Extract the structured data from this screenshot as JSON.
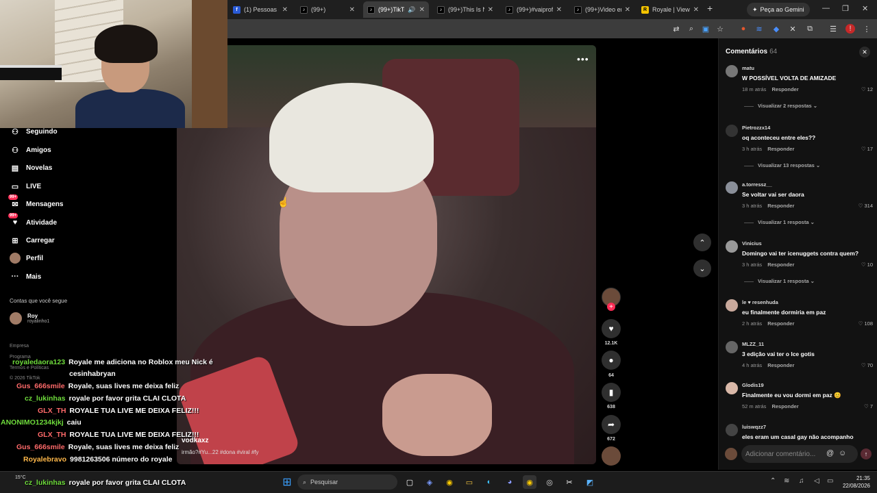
{
  "browser": {
    "tabs": [
      {
        "title": "(1) Pessoas - R",
        "icon": "facebook",
        "active": false
      },
      {
        "title": "(99+)",
        "icon": "tiktok",
        "active": false
      },
      {
        "title": "(99+)TikTo",
        "icon": "tiktok",
        "active": true
      },
      {
        "title": "(99+)This Is N",
        "icon": "tiktok",
        "active": false
      },
      {
        "title": "(99+)#vaiprofy",
        "icon": "tiktok",
        "active": false
      },
      {
        "title": "(99+)Video em",
        "icon": "tiktok",
        "active": false
      },
      {
        "title": "Royale | Viewx",
        "icon": "royale",
        "active": false
      }
    ],
    "gemini_label": "Peça ao Gemini"
  },
  "nav": {
    "items": [
      {
        "label": "Seguindo",
        "icon": "following-icon"
      },
      {
        "label": "Amigos",
        "icon": "friends-icon"
      },
      {
        "label": "Novelas",
        "icon": "novelas-icon"
      },
      {
        "label": "LIVE",
        "icon": "live-icon"
      },
      {
        "label": "Mensagens",
        "icon": "messages-icon",
        "badge": "99+"
      },
      {
        "label": "Atividade",
        "icon": "activity-icon",
        "badge": "99+"
      },
      {
        "label": "Carregar",
        "icon": "upload-icon"
      },
      {
        "label": "Perfil",
        "icon": "profile-icon"
      },
      {
        "label": "Mais",
        "icon": "more-icon"
      }
    ],
    "following_title": "Contas que você segue",
    "account": {
      "name": "Roy",
      "handle": "royalinho1"
    },
    "footer": {
      "empresa": "Empresa",
      "programa": "Programa",
      "termos": "Termos e Políticas",
      "copyright": "© 2026 TikTok"
    }
  },
  "video": {
    "author": "vodkaxz",
    "caption": "irmão?#Yu...22 #dona #viral #fy",
    "likes": "12.1K",
    "comments": "64",
    "saves": "638",
    "shares": "672"
  },
  "comments": {
    "title": "Comentários",
    "count": "64",
    "input_placeholder": "Adicionar comentário...",
    "items": [
      {
        "user": "matu",
        "text": "W POSSÍVEL VOLTA DE AMIZADE",
        "time": "18 m atrás",
        "reply": "Responder",
        "likes": "12",
        "replies": "Visualizar 2 respostas"
      },
      {
        "user": "Pietrozzx14",
        "text": "oq aconteceu entre eles??",
        "time": "3 h atrás",
        "reply": "Responder",
        "likes": "17",
        "replies": "Visualizar 13 respostas"
      },
      {
        "user": "a.torressz__",
        "text": "Se voltar vai ser daora",
        "time": "3 h atrás",
        "reply": "Responder",
        "likes": "314",
        "replies": "Visualizar 1 resposta"
      },
      {
        "user": "Vinicius",
        "text": "Domingo vai ter icenuggets contra quem?",
        "time": "3 h atrás",
        "reply": "Responder",
        "likes": "10",
        "replies": "Visualizar 1 resposta"
      },
      {
        "user": "le ♥ resenhuda",
        "text": "eu finalmente dormiria em paz",
        "time": "2 h atrás",
        "reply": "Responder",
        "likes": "108",
        "replies": ""
      },
      {
        "user": "MLZZ_11",
        "text": "3 edição vai ter o Ice gotis",
        "time": "4 h atrás",
        "reply": "Responder",
        "likes": "70",
        "replies": ""
      },
      {
        "user": "Glodis19",
        "text": "Finalmente eu vou dormi em paz 😊",
        "time": "52 m atrás",
        "reply": "Responder",
        "likes": "7",
        "replies": ""
      },
      {
        "user": "luiswqzz7",
        "text": "eles eram um casal gay não acompanho",
        "time": "",
        "reply": "",
        "likes": "",
        "replies": ""
      }
    ]
  },
  "stream_chat": [
    {
      "user": "royaledaora123",
      "color": "#6fdc3c",
      "msg": "Royale me adiciona no Roblox meu Nick é"
    },
    {
      "user": "",
      "color": "#ffffff",
      "msg": "cesinhabryan"
    },
    {
      "user": "Gus_666smile",
      "color": "#ff6a6a",
      "msg": "Royale, suas lives me deixa feliz"
    },
    {
      "user": "cz_lukinhas",
      "color": "#6fdc3c",
      "msg": "royale por favor grita CLAI CLOTA"
    },
    {
      "user": "GLX_TH",
      "color": "#ff6a6a",
      "msg": "ROYALE TUA LIVE ME DEIXA FELIZ!!!"
    },
    {
      "user": "ANONIMO1234kjkj",
      "color": "#6fdc3c",
      "msg": "caiu"
    },
    {
      "user": "GLX_TH",
      "color": "#ff6a6a",
      "msg": "ROYALE TUA LIVE ME DEIXA FELIZ!!!"
    },
    {
      "user": "Gus_666smile",
      "color": "#ff6a6a",
      "msg": "Royale, suas lives me deixa feliz"
    },
    {
      "user": "Royalebravo",
      "color": "#ffb84a",
      "msg": "9981263506 número do royale"
    },
    {
      "user": "cz_lukinhas",
      "color": "#6fdc3c",
      "msg": "royale por favor grita CLAI CLOTA"
    }
  ],
  "taskbar": {
    "weather": "15°C",
    "search_placeholder": "Pesquisar",
    "time": "21:35",
    "date": "22/08/2026"
  },
  "colors": {
    "accent": "#fe2c55",
    "panel": "#121212"
  }
}
